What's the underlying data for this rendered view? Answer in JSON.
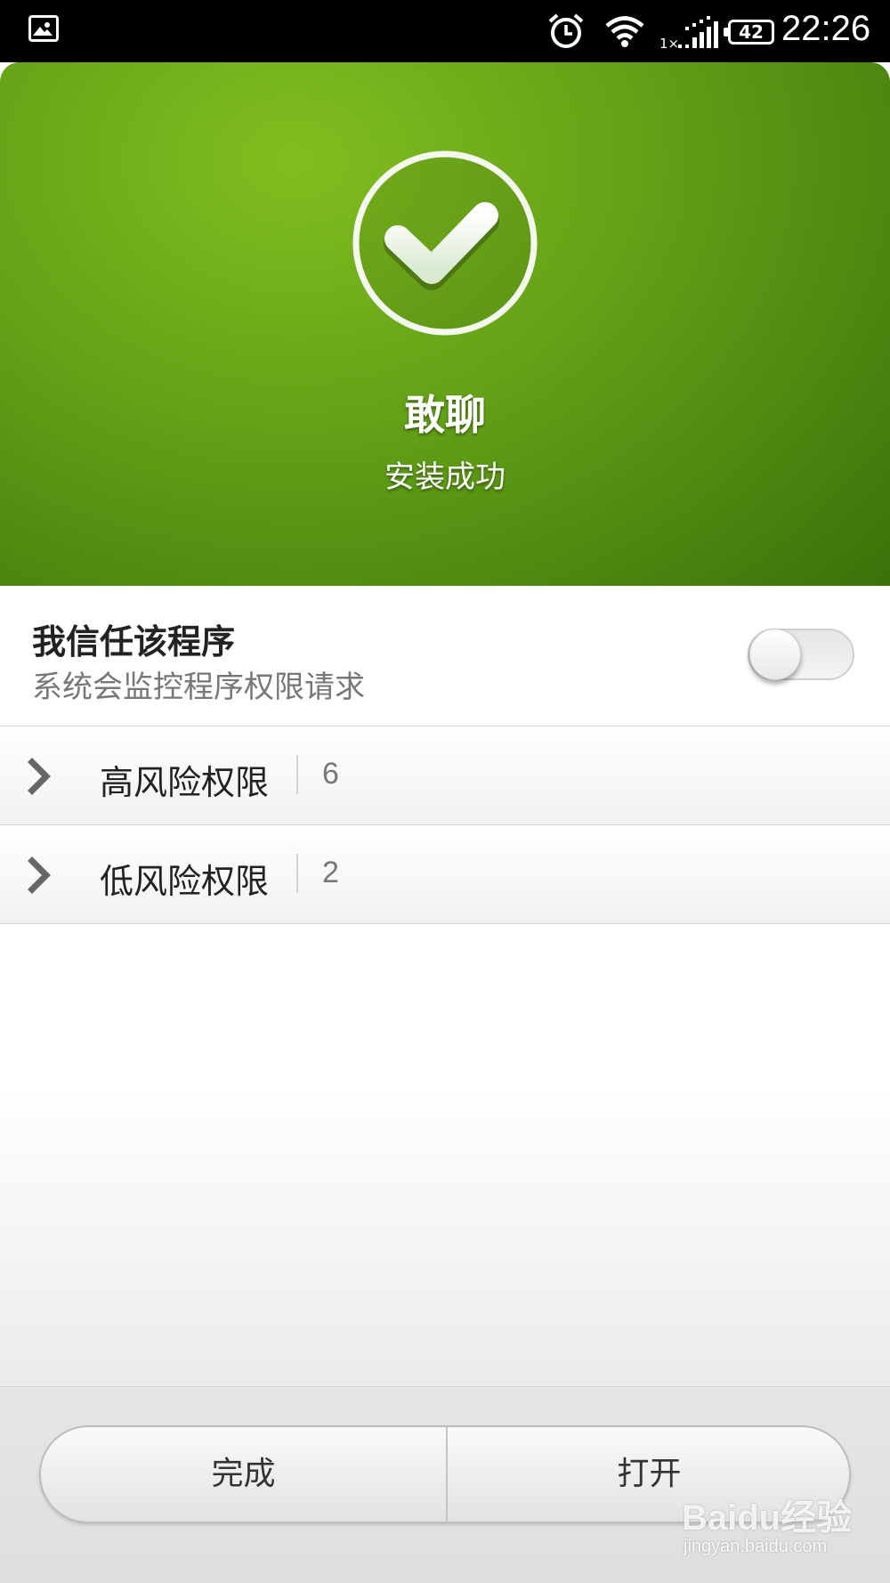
{
  "status_bar": {
    "network_type": "1×",
    "battery_level": "42",
    "clock": "22:26",
    "icons": [
      "gallery-icon",
      "alarm-icon",
      "wifi-icon",
      "signal-icon",
      "battery-icon"
    ]
  },
  "header": {
    "app_name": "敢聊",
    "status": "安装成功",
    "icon": "checkmark-circle-icon",
    "colors": {
      "green_light": "#82bd1f",
      "green_dark": "#3b720a"
    }
  },
  "trust": {
    "title": "我信任该程序",
    "description": "系统会监控程序权限请求",
    "toggle_on": false
  },
  "permissions": [
    {
      "label": "高风险权限",
      "count": "6",
      "icon": "chevron-right-icon"
    },
    {
      "label": "低风险权限",
      "count": "2",
      "icon": "chevron-right-icon"
    }
  ],
  "actions": {
    "done_label": "完成",
    "open_label": "打开"
  },
  "watermark": {
    "brand": "Baidu经验",
    "url": "jingyan.baidu.com"
  }
}
